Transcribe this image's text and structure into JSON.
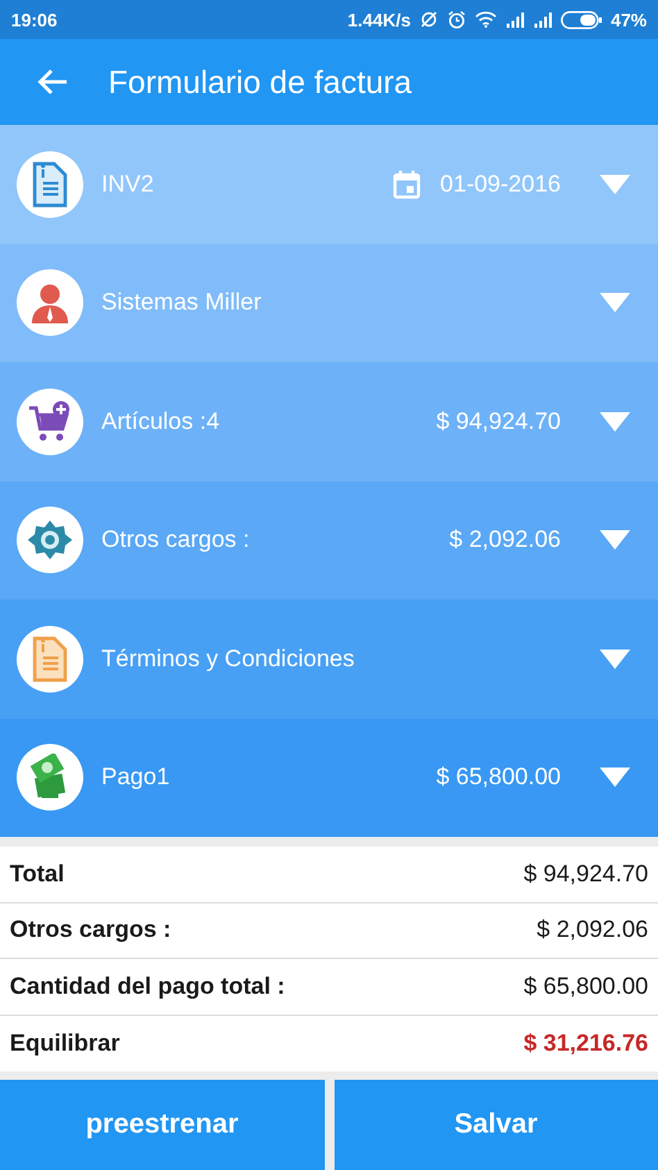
{
  "status_bar": {
    "time": "19:06",
    "speed": "1.44K/s",
    "battery": "47%"
  },
  "toolbar": {
    "title": "Formulario de factura"
  },
  "sections": [
    {
      "kind": "invoice",
      "label": "INV2",
      "date": "01-09-2016"
    },
    {
      "kind": "client",
      "label": "Sistemas Miller"
    },
    {
      "kind": "items",
      "label": "Artículos :4",
      "amount": "$ 94,924.70"
    },
    {
      "kind": "charges",
      "label": "Otros cargos :",
      "amount": "$ 2,092.06"
    },
    {
      "kind": "terms",
      "label": "Términos y Condiciones"
    },
    {
      "kind": "payment",
      "label": "Pago1",
      "amount": "$ 65,800.00"
    }
  ],
  "summary": [
    {
      "label": "Total",
      "value": "$ 94,924.70",
      "highlight": false
    },
    {
      "label": "Otros cargos :",
      "value": "$ 2,092.06",
      "highlight": false
    },
    {
      "label": "Cantidad del pago total :",
      "value": "$ 65,800.00",
      "highlight": false
    },
    {
      "label": "Equilibrar",
      "value": "$ 31,216.76",
      "highlight": true
    }
  ],
  "buttons": [
    "preestrenar",
    "Salvar"
  ]
}
